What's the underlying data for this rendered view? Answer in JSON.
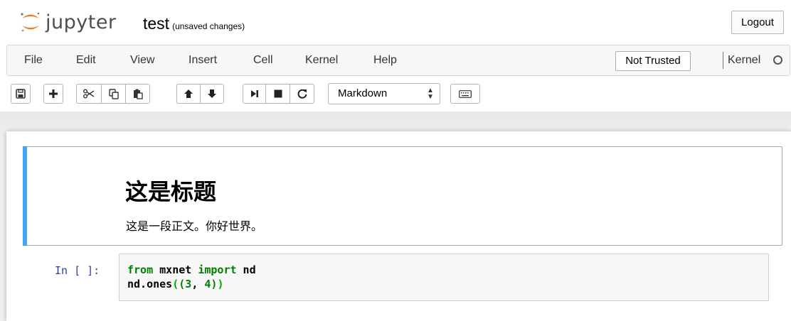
{
  "header": {
    "logo_text": "jupyter",
    "notebook_name": "test",
    "notebook_status": "(unsaved changes)",
    "logout_label": "Logout"
  },
  "menubar": {
    "items": [
      "File",
      "Edit",
      "View",
      "Insert",
      "Cell",
      "Kernel",
      "Help"
    ],
    "trusted_label": "Not Trusted",
    "kernel_name": "Kernel"
  },
  "toolbar": {
    "buttons": [
      {
        "name": "save-button",
        "icon": "floppy-disk-icon"
      },
      {
        "name": "insert-cell-button",
        "icon": "plus-icon"
      },
      {
        "name": "cut-button",
        "icon": "scissors-icon"
      },
      {
        "name": "copy-button",
        "icon": "copy-icon"
      },
      {
        "name": "paste-button",
        "icon": "clipboard-icon"
      },
      {
        "name": "move-up-button",
        "icon": "arrow-up-icon"
      },
      {
        "name": "move-down-button",
        "icon": "arrow-down-icon"
      },
      {
        "name": "run-button",
        "icon": "step-forward-icon"
      },
      {
        "name": "stop-button",
        "icon": "stop-icon"
      },
      {
        "name": "restart-button",
        "icon": "refresh-icon"
      },
      {
        "name": "command-palette-button",
        "icon": "keyboard-icon"
      }
    ],
    "cell_type": "Markdown"
  },
  "cells": {
    "markdown": {
      "heading": "这是标题",
      "body": "这是一段正文。你好世界。"
    },
    "code": {
      "prompt": "In [ ]:",
      "line1": {
        "kw1": "from",
        "mod": " mxnet ",
        "kw2": "import",
        "name": " nd"
      },
      "line2": {
        "prefix": "nd.ones",
        "open_outer": "(",
        "open_inner": "(",
        "n1": "3",
        "comma": ", ",
        "n2": "4",
        "close_inner": ")",
        "close_outer": ")"
      }
    }
  },
  "colors": {
    "selected_cell_bar": "#42a5f5",
    "prompt": "#303f9f",
    "keyword": "#008000",
    "logo_orange": "#f37726"
  }
}
